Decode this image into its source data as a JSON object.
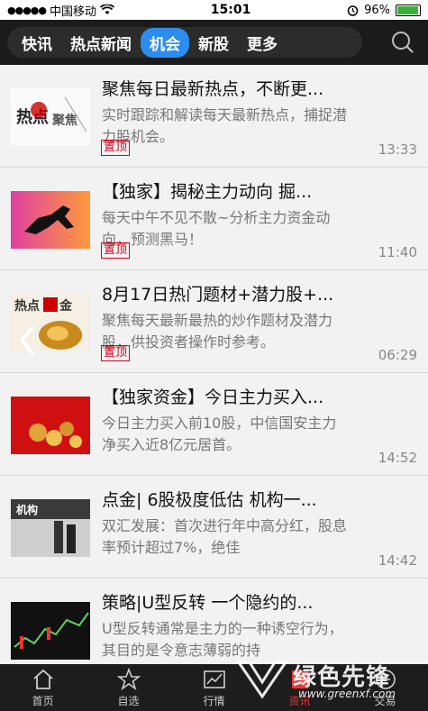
{
  "status_bar": {
    "carrier": "中国移动",
    "time": "15:01",
    "battery": "96%",
    "battery_level": 0.96
  },
  "tabs": [
    {
      "label": "快讯",
      "active": false
    },
    {
      "label": "热点新闻",
      "active": false
    },
    {
      "label": "机会",
      "active": true
    },
    {
      "label": "新股",
      "active": false
    },
    {
      "label": "更多",
      "active": false
    }
  ],
  "articles": [
    {
      "title": "聚焦每日最新热点，不断更...",
      "summary": "实时跟踪和解读每天最新热点，捕捉潜力股机会。",
      "pinned": "置顶",
      "time": "13:33",
      "thumb_text": "热点聚焦"
    },
    {
      "title": "【独家】揭秘主力动向 掘...",
      "summary": "每天中午不见不散~分析主力资金动向，预测黑马！",
      "pinned": "置顶",
      "time": "11:40",
      "thumb_text": ""
    },
    {
      "title": "8月17日热门题材+潜力股+...",
      "summary": "聚焦每天最新最热的炒作题材及潜力股，供投资者操作时参考。",
      "pinned": "置顶",
      "time": "06:29",
      "thumb_text": "热点掘金"
    },
    {
      "title": "【独家资金】今日主力买入...",
      "summary": "今日主力买入前10股，中信国安主力净买入近8亿元居首。",
      "pinned": "",
      "time": "14:52",
      "thumb_text": ""
    },
    {
      "title": "点金| 6股极度低估 机构一...",
      "summary": "双汇发展：首次进行年中高分红，股息率预计超过7%，绝佳",
      "pinned": "",
      "time": "14:42",
      "thumb_text": "机构"
    },
    {
      "title": "策略|U型反转 一个隐约的...",
      "summary": "U型反转通常是主力的一种诱空行为，其目的是令意志薄弱的持",
      "pinned": "",
      "time": "",
      "thumb_text": ""
    }
  ],
  "bottom_nav": [
    {
      "label": "首页",
      "icon": "home-icon"
    },
    {
      "label": "自选",
      "icon": "star-icon"
    },
    {
      "label": "行情",
      "icon": "chart-icon"
    },
    {
      "label": "资讯",
      "icon": "news-icon",
      "active": true
    },
    {
      "label": "交易",
      "icon": "trade-icon"
    }
  ],
  "watermark": {
    "text": "绿色先锋",
    "sub": "www.greenxf.com"
  }
}
